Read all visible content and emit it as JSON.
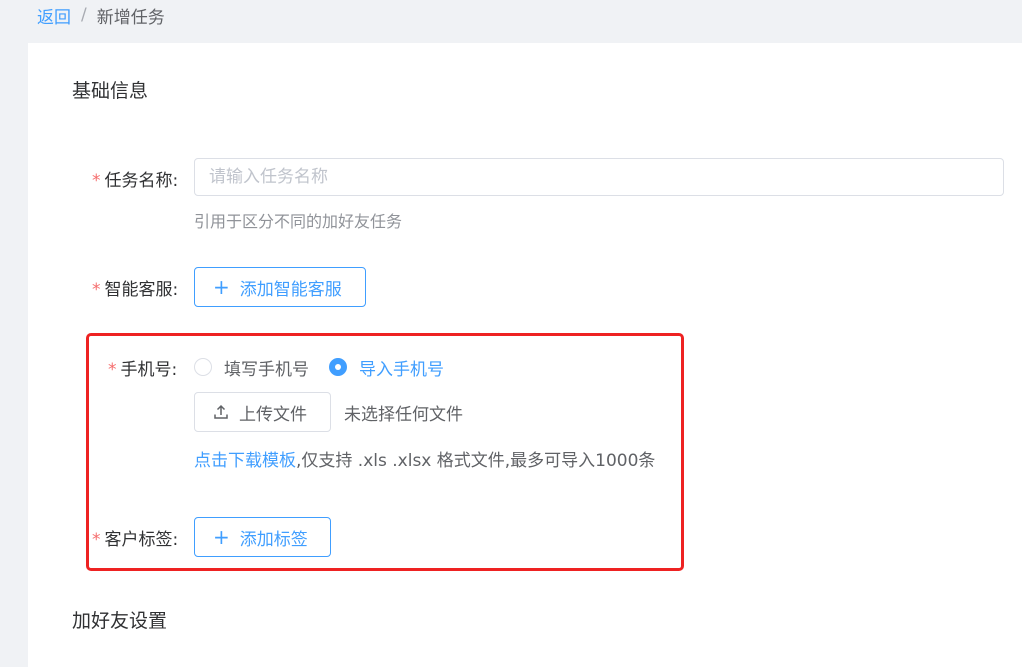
{
  "breadcrumb": {
    "back": "返回",
    "separator": "/",
    "current": "新增任务"
  },
  "sections": {
    "basic": "基础信息",
    "add_friend": "加好友设置"
  },
  "task_name": {
    "required_mark": "*",
    "label": "任务名称:",
    "placeholder": "请输入任务名称",
    "value": "",
    "hint": "引用于区分不同的加好友任务"
  },
  "smart_service": {
    "required_mark": "*",
    "label": "智能客服:",
    "button": "添加智能客服"
  },
  "phone": {
    "required_mark": "*",
    "label": "手机号:",
    "options": [
      "填写手机号",
      "导入手机号"
    ],
    "selected": "导入手机号",
    "upload_button": "上传文件",
    "no_file": "未选择任何文件",
    "template_link": "点击下载模板",
    "template_note": ",仅支持 .xls .xlsx 格式文件,最多可导入1000条"
  },
  "customer_tag": {
    "required_mark": "*",
    "label": "客户标签:",
    "button": "添加标签"
  },
  "colors": {
    "primary": "#409eff",
    "required": "#f56c6c",
    "highlight": "#ee2222"
  },
  "icons": {
    "plus": "plus-icon",
    "upload": "upload-icon"
  }
}
